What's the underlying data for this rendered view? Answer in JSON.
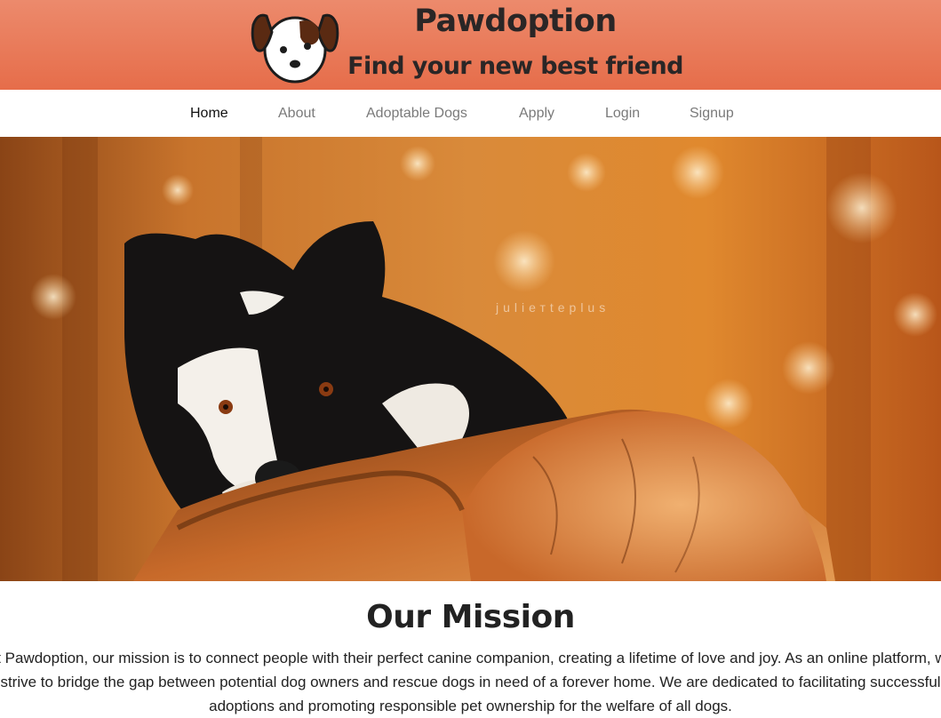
{
  "header": {
    "title": "Pawdoption",
    "subtitle": "Find your new best friend",
    "logo_icon": "dog-face-icon",
    "gradient_top": "#ec8a6c",
    "gradient_bottom": "#e66d4a"
  },
  "nav": {
    "items": [
      {
        "label": "Home",
        "active": true
      },
      {
        "label": "About",
        "active": false
      },
      {
        "label": "Adoptable Dogs",
        "active": false
      },
      {
        "label": "Apply",
        "active": false
      },
      {
        "label": "Login",
        "active": false
      },
      {
        "label": "Signup",
        "active": false
      }
    ]
  },
  "hero": {
    "watermark": "juliетteplus",
    "subject": "border collie resting on log in autumn forest"
  },
  "mission": {
    "title": "Our Mission",
    "text": "At Pawdoption, our mission is to connect people with their perfect canine companion, creating a lifetime of love and joy. As an online platform, we strive to bridge the gap between potential dog owners and rescue dogs in need of a forever home. We are dedicated to facilitating successful adoptions and promoting responsible pet ownership for the welfare of all dogs."
  },
  "colors": {
    "nav_active": "#111111",
    "nav_inactive": "#7a7a7a",
    "heading": "#222222"
  }
}
